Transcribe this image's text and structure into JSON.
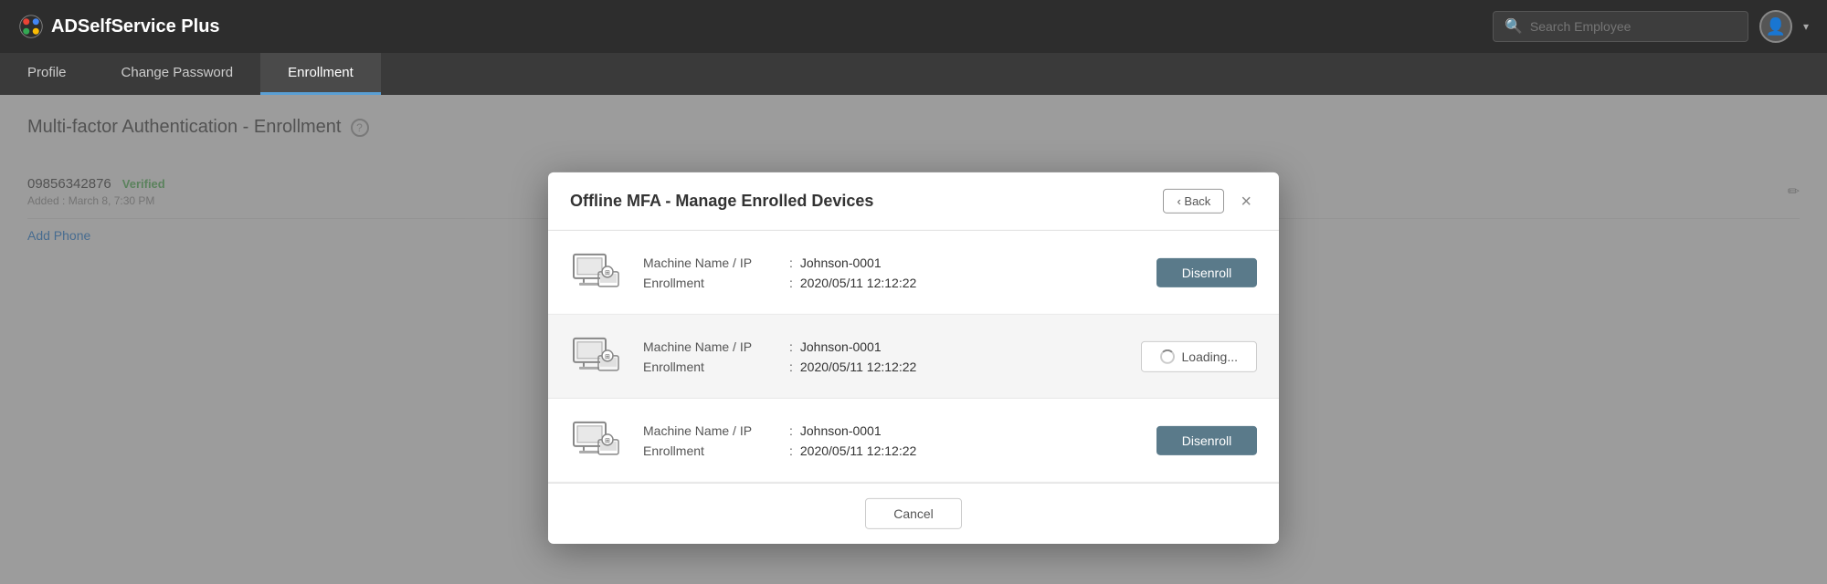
{
  "brand": {
    "name": "ADSelfService Plus"
  },
  "navbar": {
    "search_placeholder": "Search Employee",
    "search_icon": "🔍"
  },
  "tabs": [
    {
      "id": "profile",
      "label": "Profile",
      "active": false
    },
    {
      "id": "change-password",
      "label": "Change Password",
      "active": false
    },
    {
      "id": "enrollment",
      "label": "Enrollment",
      "active": true
    }
  ],
  "page": {
    "title": "Multi-factor Authentication - Enrollment",
    "help_icon": "?"
  },
  "modal": {
    "title": "Offline MFA - Manage Enrolled Devices",
    "back_label": "‹ Back",
    "close_label": "×",
    "devices": [
      {
        "machine_name_label": "Machine Name / IP",
        "machine_name_separator": ":",
        "machine_name_value": "Johnson-0001",
        "enrollment_label": "Enrollment",
        "enrollment_separator": ":",
        "enrollment_value": "2020/05/11  12:12:22",
        "button_type": "disenroll",
        "button_label": "Disenroll"
      },
      {
        "machine_name_label": "Machine Name / IP",
        "machine_name_separator": ":",
        "machine_name_value": "Johnson-0001",
        "enrollment_label": "Enrollment",
        "enrollment_separator": ":",
        "enrollment_value": "2020/05/11  12:12:22",
        "button_type": "loading",
        "button_label": "Loading..."
      },
      {
        "machine_name_label": "Machine Name / IP",
        "machine_name_separator": ":",
        "machine_name_value": "Johnson-0001",
        "enrollment_label": "Enrollment",
        "enrollment_separator": ":",
        "enrollment_value": "2020/05/11  12:12:22",
        "button_type": "disenroll",
        "button_label": "Disenroll"
      }
    ],
    "footer": {
      "cancel_label": "Cancel"
    }
  },
  "background": {
    "phone_number": "09856342876",
    "verified_label": "Verified",
    "added_info": "Added : March 8, 7:30 PM",
    "add_phone_label": "Add Phone"
  }
}
